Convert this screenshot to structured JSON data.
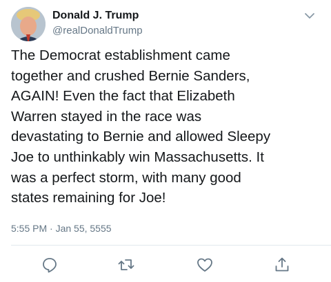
{
  "tweet": {
    "display_name": "Donald J. Trump",
    "handle": "@realDonaldTrump",
    "text": "The Democrat establishment came\ntogether and crushed Bernie Sanders,\nAGAIN! Even the fact that Elizabeth\nWarren stayed in the race was\ndevastating to Bernie and allowed Sleepy\nJoe to unthinkably win Massachusetts. It\nwas a perfect storm, with many good\nstates remaining for Joe!",
    "timestamp": "5:55 PM · Jan 55, 5555"
  },
  "icons": {
    "menu": "chevron-down-icon",
    "reply": "reply-icon",
    "retweet": "retweet-icon",
    "like": "heart-icon",
    "share": "share-icon"
  },
  "colors": {
    "text": "#14171a",
    "secondary": "#657786",
    "icon": "#657786",
    "divider": "#e1e8ed"
  }
}
